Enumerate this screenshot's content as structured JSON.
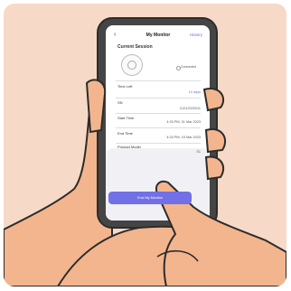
{
  "app": {
    "title": "My Monitor",
    "history_label": "History",
    "back_icon": "chevron-left-icon"
  },
  "session": {
    "heading": "Current Session",
    "device_icon": "monitor-device-icon",
    "status": "Connected"
  },
  "details": [
    {
      "label": "Time Left",
      "value": "10 days"
    },
    {
      "label": "SN",
      "value": "21212022011"
    },
    {
      "label": "Start Time",
      "value": "4:03 PM, 01 Mar 2023"
    },
    {
      "label": "End Time",
      "value": "4:03 PM, 15 Mar 2023"
    },
    {
      "label": "Product Model",
      "value": "S1"
    }
  ],
  "actions": {
    "end_label": "End My Monitor"
  },
  "colors": {
    "background": "#f6d9c6",
    "skin": "#f3b58d",
    "phone_body": "#4a4a4a",
    "accent": "#7270e6"
  }
}
